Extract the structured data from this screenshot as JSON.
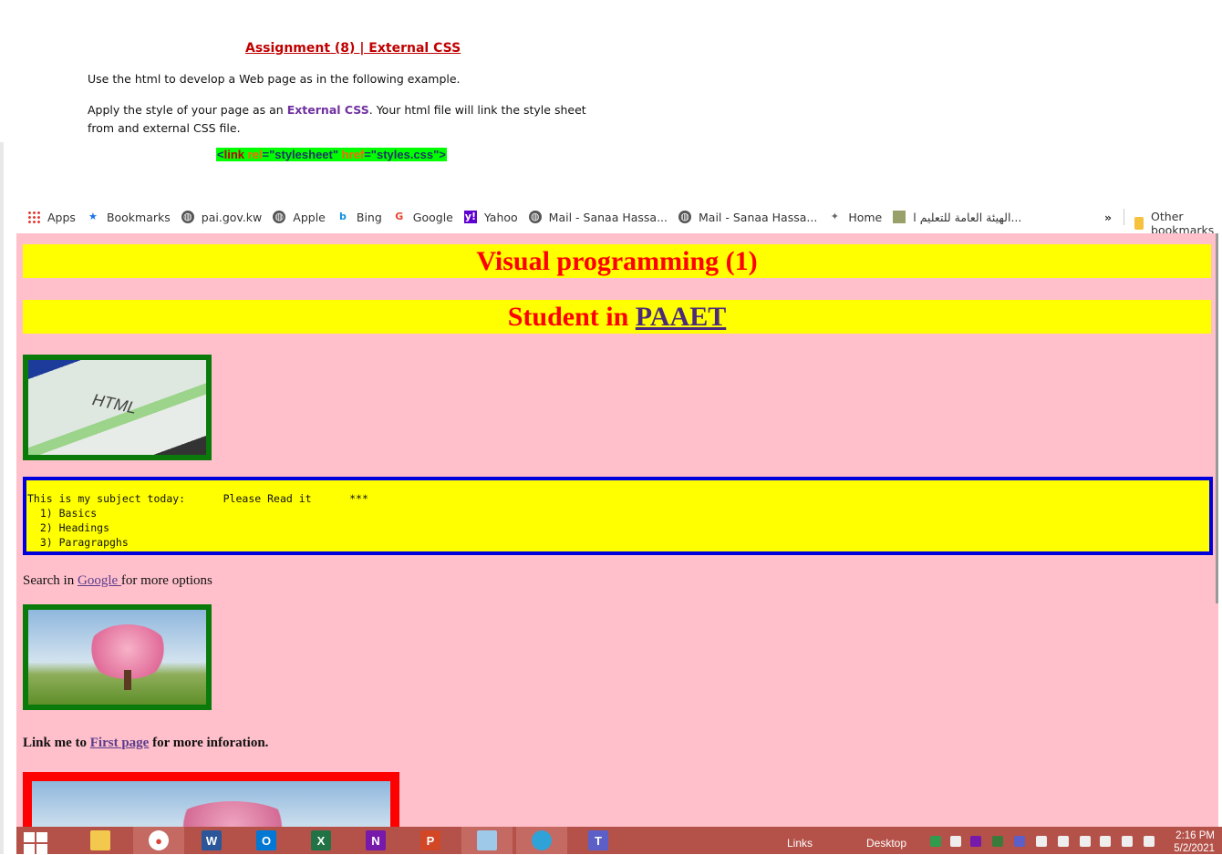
{
  "document": {
    "title": "Assignment (8)  |  External CSS",
    "line1": "Use the html to develop a Web page as in the following example.",
    "line2_before": "Apply the style of your page as an ",
    "line2_highlight": "External CSS",
    "line2_after": ".  Your html file will link the style sheet from and external CSS file.",
    "code": {
      "lt": "<",
      "tag": "link ",
      "attr1": "rel",
      "eq1": "=",
      "val1": "\"stylesheet\"",
      "attr2": " href",
      "eq2": "=",
      "val2": "\"styles.css\"",
      "gt": ">"
    }
  },
  "bookmarks": {
    "items": [
      {
        "label": "Apps",
        "icon": "apps-icon"
      },
      {
        "label": "Bookmarks",
        "icon": "star-icon"
      },
      {
        "label": "pai.gov.kw",
        "icon": "globe-icon"
      },
      {
        "label": "Apple",
        "icon": "globe-icon"
      },
      {
        "label": "Bing",
        "icon": "bing-icon"
      },
      {
        "label": "Google",
        "icon": "google-icon"
      },
      {
        "label": "Yahoo",
        "icon": "yahoo-icon"
      },
      {
        "label": "Mail - Sanaa Hassa...",
        "icon": "globe-icon"
      },
      {
        "label": "Mail - Sanaa Hassa...",
        "icon": "globe-icon"
      },
      {
        "label": "Home",
        "icon": "home-icon"
      },
      {
        "label": "الهيئة العامة للتعليم ا...",
        "icon": "site-icon"
      }
    ],
    "more": "»",
    "other": "Other bookmarks"
  },
  "page": {
    "heading1": "Visual programming (1)",
    "heading2_text": "Student in ",
    "heading2_link": "PAAET",
    "image1_caption": "HTML",
    "pre_line1": "This is my subject today:      Please Read it      ***",
    "pre_line2": "  1) Basics",
    "pre_line3": "  2) Headings",
    "pre_line4": "  3) Paragrapghs",
    "search_before": "Search in ",
    "search_link": "Google ",
    "search_after": "for more options",
    "link_before": "Link me to ",
    "link_text": "First page",
    "link_after": " for more inforation."
  },
  "taskbar": {
    "links_label": "Links",
    "desktop_label": "Desktop",
    "time": "2:16 PM",
    "date": "5/2/2021"
  },
  "colors": {
    "page_bg": "#ffc0cb",
    "heading_bg": "#ffff00",
    "heading_text": "#ff0000",
    "pre_border": "#0000dd",
    "img_border": "#0a7a0a",
    "img3_border": "#ff0000",
    "taskbar": "#b4524a"
  }
}
